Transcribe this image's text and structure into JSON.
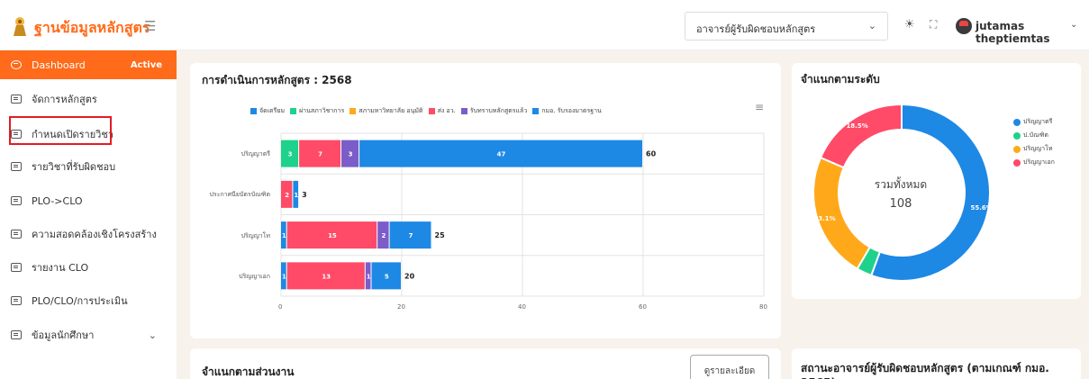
{
  "header": {
    "brand": "ฐานข้อมูลหลักสูตร",
    "role_select": "อาจารย์ผู้รับผิดชอบหลักสูตร",
    "username": "jutamas theptiemtas"
  },
  "sidebar": {
    "items": [
      {
        "label": "Dashboard",
        "badge": "Active"
      },
      {
        "label": "จัดการหลักสูตร"
      },
      {
        "label": "กำหนดเปิดรายวิชา"
      },
      {
        "label": "รายวิชาที่รับผิดชอบ"
      },
      {
        "label": "PLO->CLO"
      },
      {
        "label": "ความสอดคล้องเชิงโครงสร้าง"
      },
      {
        "label": "รายงาน CLO"
      },
      {
        "label": "PLO/CLO/การประเมิน"
      },
      {
        "label": "ข้อมูลนักศึกษา"
      }
    ]
  },
  "cards": {
    "bar_title": "การดำเนินการหลักสูตร : 2568",
    "donut_title": "จำแนกตามระดับ",
    "dept_title": "จำแนกตามส่วนงาน",
    "detail_button": "ดูรายละเอียด",
    "status_title": "สถานะอาจารย์ผู้รับผิดชอบหลักสูตร (ตามเกณฑ์ กมอ. 2565)"
  },
  "chart_data": [
    {
      "type": "bar",
      "orientation": "horizontal",
      "stacked": true,
      "categories": [
        "ปริญญาตรี",
        "ประกาศนียบัตรบัณฑิต",
        "ปริญญาโท",
        "ปริญญาเอก"
      ],
      "series": [
        {
          "name": "จัดเตรียม",
          "color": "#1e88e5",
          "values": [
            0,
            0,
            1,
            1
          ]
        },
        {
          "name": "ผ่านสภาวิชาการ",
          "color": "#1ed28c",
          "values": [
            3,
            0,
            0,
            0
          ]
        },
        {
          "name": "สภามหาวิทยาลัย อนุมัติ",
          "color": "#ffa91a",
          "values": [
            0,
            0,
            0,
            0
          ]
        },
        {
          "name": "ส่ง อว.",
          "color": "#ff4a68",
          "values": [
            7,
            2,
            15,
            13
          ]
        },
        {
          "name": "รับทราบหลักสูตรแล้ว",
          "color": "#7b5cc9",
          "values": [
            3,
            0,
            2,
            1
          ]
        },
        {
          "name": "กมอ. รับรองมาตรฐาน",
          "color": "#1e88e5",
          "values": [
            47,
            1,
            7,
            5
          ]
        }
      ],
      "totals": [
        60,
        3,
        25,
        20
      ],
      "xlim": [
        0,
        80
      ],
      "xticks": [
        0,
        20,
        40,
        60,
        80
      ],
      "legend": "top"
    },
    {
      "type": "pie",
      "donut": true,
      "labels": [
        "ปริญญาตรี",
        "ป.บัณฑิต",
        "ปริญญาโท",
        "ปริญญาเอก"
      ],
      "values": [
        55.6,
        2.8,
        23.1,
        18.5
      ],
      "colors": [
        "#1e88e5",
        "#1ed28c",
        "#ffa91a",
        "#ff4a68"
      ],
      "value_labels": [
        "55.6%",
        "",
        "23.1%",
        "18.5%"
      ],
      "center_label": "รวมทั้งหมด",
      "center_value": "108",
      "legend": "right"
    }
  ]
}
